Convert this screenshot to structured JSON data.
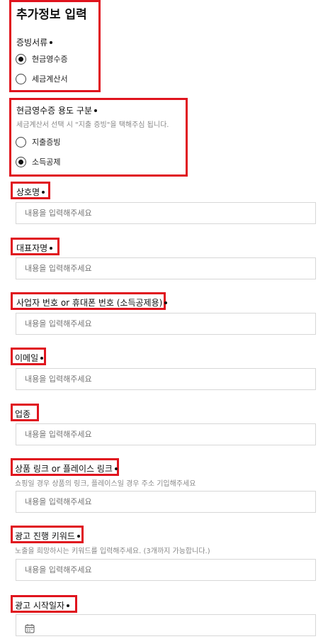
{
  "section_title": "추가정보 입력",
  "proof_document": {
    "label": "증빙서류",
    "options": [
      {
        "label": "현금영수증",
        "selected": true
      },
      {
        "label": "세금계산서",
        "selected": false
      }
    ]
  },
  "receipt_usage": {
    "label": "현금영수증 용도 구분",
    "helper": "세금계산서 선택 시 \"지출 증빙\"을 택해주심 됩니다.",
    "options": [
      {
        "label": "지출증빙",
        "selected": false
      },
      {
        "label": "소득공제",
        "selected": true
      }
    ]
  },
  "fields": {
    "company_name": {
      "label": "상호명",
      "placeholder": "내용을 입력해주세요"
    },
    "ceo_name": {
      "label": "대표자명",
      "placeholder": "내용을 입력해주세요"
    },
    "biz_number": {
      "label": "사업자 번호 or 휴대폰 번호 (소득공제용)",
      "placeholder": "내용을 입력해주세요"
    },
    "email": {
      "label": "이메일",
      "placeholder": "내용을 입력해주세요"
    },
    "industry": {
      "label": "업종",
      "placeholder": "내용을 입력해주세요"
    },
    "product_link": {
      "label": "상품 링크 or 플레이스 링크",
      "helper": "쇼핑일 경우 상품의 링크, 플레이스일 경우 주소 기입해주세요",
      "placeholder": "내용을 입력해주세요"
    },
    "ad_keywords": {
      "label": "광고 진행 키워드",
      "helper": "노출을 희망하시는 키워드를 입력해주세요. (3개까지 가능합니다.)",
      "placeholder": "내용을 입력해주세요"
    },
    "ad_start_date": {
      "label": "광고 시작일자",
      "icon": "calendar-icon"
    }
  },
  "colors": {
    "highlight": "#e0141e",
    "selected_radio": "#111111"
  }
}
